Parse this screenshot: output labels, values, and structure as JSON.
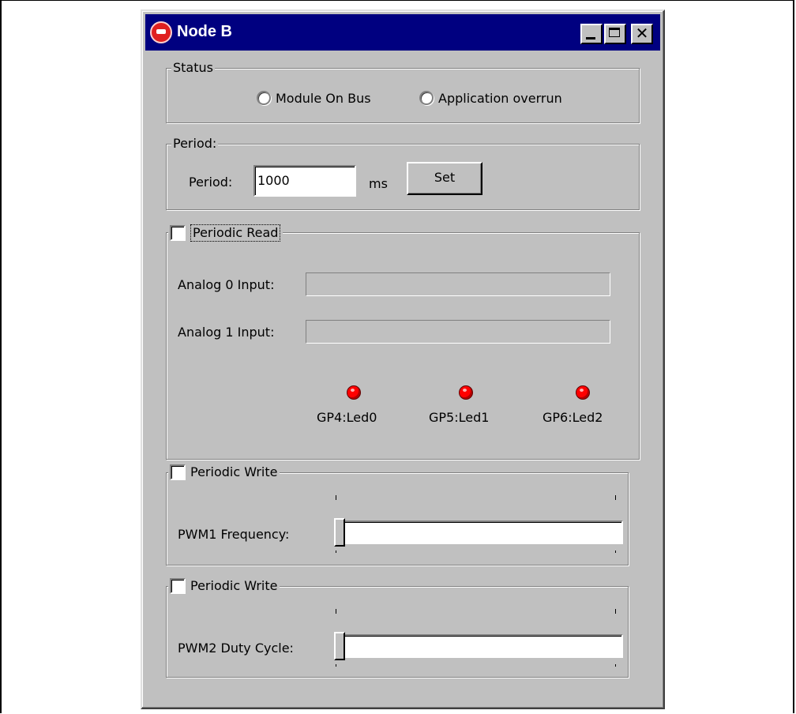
{
  "window": {
    "title": "Node B",
    "controls": [
      "minimize",
      "maximize",
      "close"
    ],
    "close_glyph": "✕"
  },
  "status": {
    "legend": "Status",
    "radios": [
      {
        "label": "Module On Bus",
        "checked": false
      },
      {
        "label": "Application overrun",
        "checked": false
      }
    ]
  },
  "period": {
    "legend": "Period:",
    "label": "Period:",
    "value": "1000",
    "unit": "ms",
    "set_label": "Set"
  },
  "periodic_read": {
    "checkbox_label": "Periodic Read",
    "checked": false,
    "analog0_label": "Analog 0 Input:",
    "analog0_value": "",
    "analog1_label": "Analog 1 Input:",
    "analog1_value": "",
    "leds": [
      {
        "label": "GP4:Led0",
        "color": "#ff0000"
      },
      {
        "label": "GP5:Led1",
        "color": "#ff0000"
      },
      {
        "label": "GP6:Led2",
        "color": "#ff0000"
      }
    ]
  },
  "pwm1": {
    "checkbox_label": "Periodic Write",
    "checked": false,
    "slider_label": "PWM1 Frequency:",
    "slider_value": 0
  },
  "pwm2": {
    "checkbox_label": "Periodic Write",
    "checked": false,
    "slider_label": "PWM2 Duty Cycle:",
    "slider_value": 0
  },
  "colors": {
    "title_bar": "#000080",
    "face": "#c0c0c0",
    "led_on": "#ff0000"
  }
}
